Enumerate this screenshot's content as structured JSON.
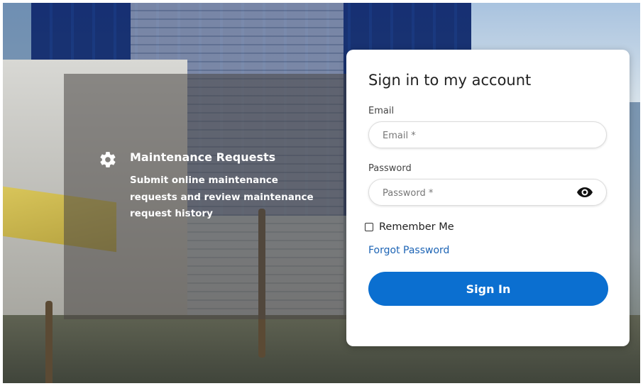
{
  "feature": {
    "icon": "gear-icon",
    "title": "Maintenance Requests",
    "description": "Submit online maintenance requests and review maintenance request history"
  },
  "login": {
    "heading": "Sign in to my account",
    "email_label": "Email",
    "email_placeholder": "Email *",
    "password_label": "Password",
    "password_placeholder": "Password *",
    "password_toggle_icon": "eye-icon",
    "remember_label": "Remember Me",
    "forgot_label": "Forgot Password",
    "signin_label": "Sign In"
  },
  "colors": {
    "primary": "#0b6fd0",
    "link": "#1d64b5"
  }
}
